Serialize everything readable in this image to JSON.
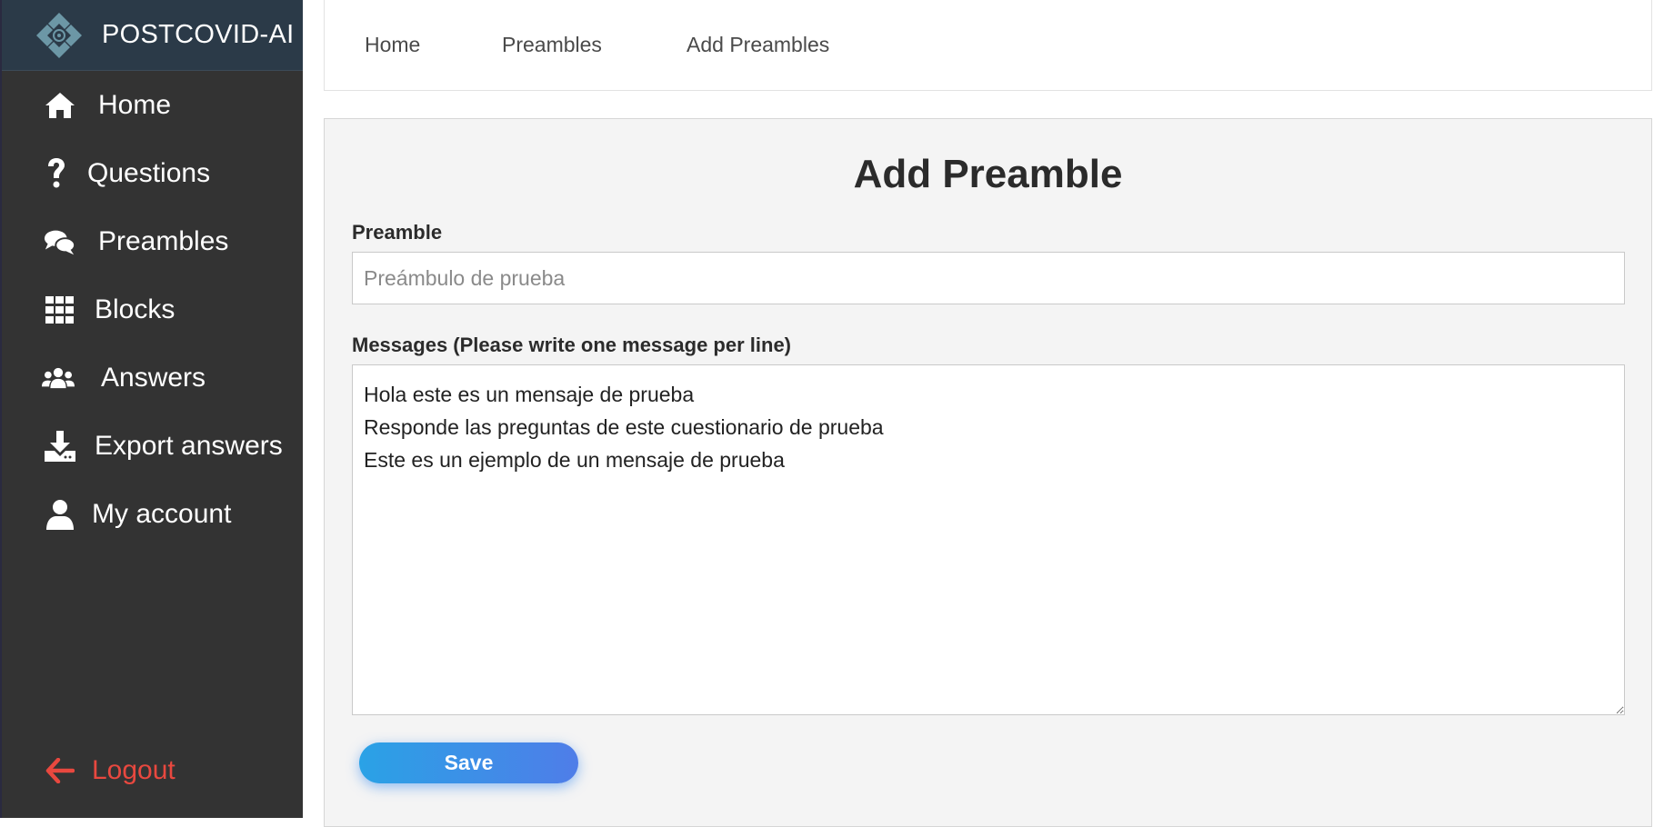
{
  "brand": {
    "name": "POSTCOVID-AI",
    "logo_icon": "postcovid-logo"
  },
  "sidebar": {
    "items": [
      {
        "label": "Home",
        "icon": "home-icon"
      },
      {
        "label": "Questions",
        "icon": "question-icon"
      },
      {
        "label": "Preambles",
        "icon": "comments-icon"
      },
      {
        "label": "Blocks",
        "icon": "grid-icon"
      },
      {
        "label": "Answers",
        "icon": "users-icon"
      },
      {
        "label": "Export answers",
        "icon": "download-icon"
      },
      {
        "label": "My account",
        "icon": "user-icon"
      }
    ],
    "logout": {
      "label": "Logout",
      "icon": "arrow-left-icon",
      "color": "#e8483f"
    }
  },
  "breadcrumb": {
    "items": [
      "Home",
      "Preambles",
      "Add Preambles"
    ]
  },
  "form": {
    "title": "Add Preamble",
    "preamble_label": "Preamble",
    "preamble_placeholder": "Preámbulo de prueba",
    "preamble_value": "",
    "messages_label": "Messages (Please write one message per line)",
    "messages_value": "Hola este es un mensaje de prueba\nResponde las preguntas de este cuestionario de prueba\nEste es un ejemplo de un mensaje de prueba",
    "save_label": "Save"
  },
  "colors": {
    "sidebar_bg": "#333333",
    "brand_bg": "#2b3a48",
    "accent_gradient_start": "#2aa2e6",
    "accent_gradient_end": "#4f7de8",
    "logout": "#e8483f"
  }
}
